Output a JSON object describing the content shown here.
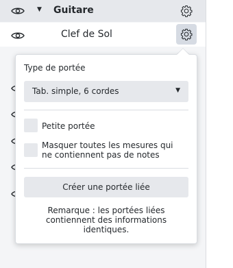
{
  "tracks": [
    {
      "label": "Guitare",
      "caret": "▼"
    },
    {
      "label": "Clef de Sol"
    }
  ],
  "popup": {
    "section_title": "Type de portée",
    "staff_type": {
      "selected": "Tab. simple, 6 cordes",
      "caret": "▼"
    },
    "checkbox_small_staff": {
      "label": "Petite portée",
      "checked": false
    },
    "checkbox_hide_empty": {
      "label_line1": "Masquer toutes les mesures qui",
      "label_line2": "ne contiennent pas de notes",
      "checked": false
    },
    "create_linked_button": "Créer une portée liée",
    "note_line1": "Remarque : les portées liées",
    "note_line2": "contiennent des informations",
    "note_line3": "identiques."
  }
}
